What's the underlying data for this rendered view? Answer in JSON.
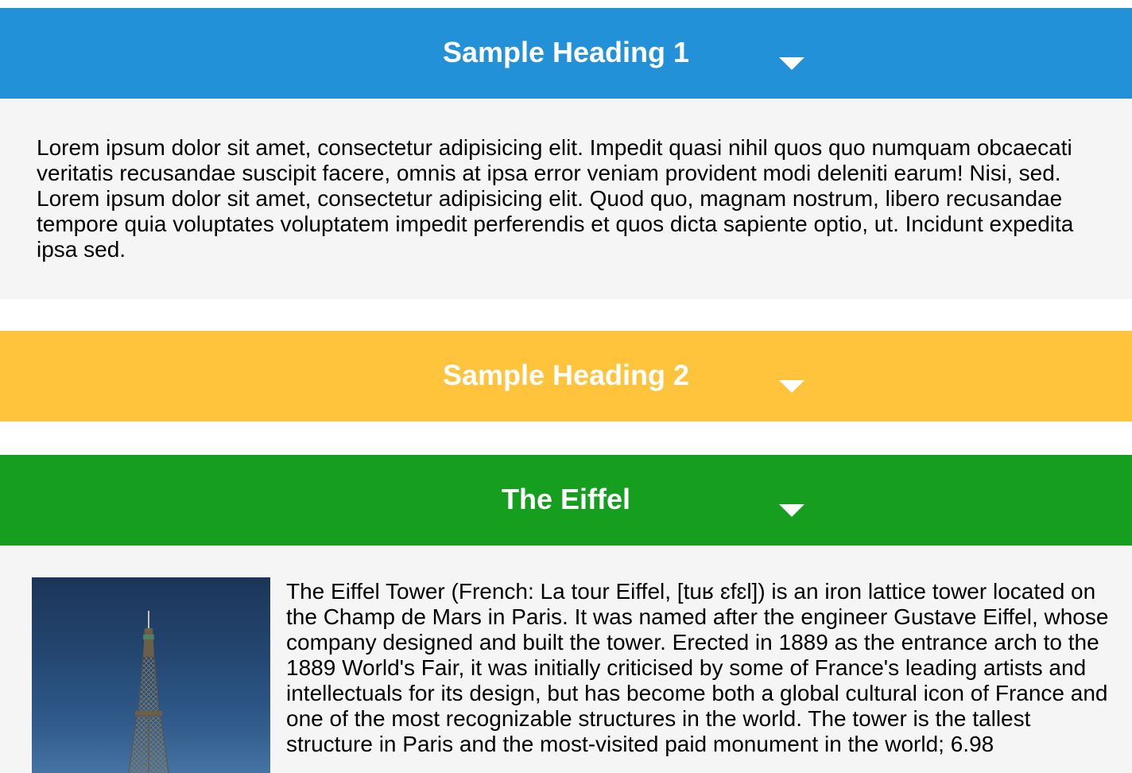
{
  "colors": {
    "heading1_bg": "#2291d7",
    "heading2_bg": "#ffc33c",
    "heading3_bg": "#169e1f",
    "panel_bg": "#f5f5f5",
    "heading_text": "#ffffff"
  },
  "accordion": {
    "sections": [
      {
        "title": "Sample Heading 1",
        "icon": "caret-down-icon",
        "expanded": true,
        "body": "Lorem ipsum dolor sit amet, consectetur adipisicing elit. Impedit quasi nihil quos quo numquam obcaecati veritatis recusandae suscipit facere, omnis at ipsa error veniam provident modi deleniti earum! Nisi, sed. Lorem ipsum dolor sit amet, consectetur adipisicing elit. Quod quo, magnam nostrum, libero recusandae tempore quia voluptates voluptatem impedit perferendis et quos dicta sapiente optio, ut. Incidunt expedita ipsa sed."
      },
      {
        "title": "Sample Heading 2",
        "icon": "caret-down-icon",
        "expanded": false
      },
      {
        "title": "The Eiffel",
        "icon": "caret-down-icon",
        "expanded": true,
        "image": "eiffel-tower-photo",
        "body": "The Eiffel Tower (French: La tour Eiffel, [tuʁ ɛfɛl]) is an iron lattice tower located on the Champ de Mars in Paris. It was named after the engineer Gustave Eiffel, whose company designed and built the tower. Erected in 1889 as the entrance arch to the 1889 World's Fair, it was initially criticised by some of France's leading artists and intellectuals for its design, but has become both a global cultural icon of France and one of the most recognizable structures in the world. The tower is the tallest structure in Paris and the most-visited paid monument in the world; 6.98"
      }
    ]
  }
}
